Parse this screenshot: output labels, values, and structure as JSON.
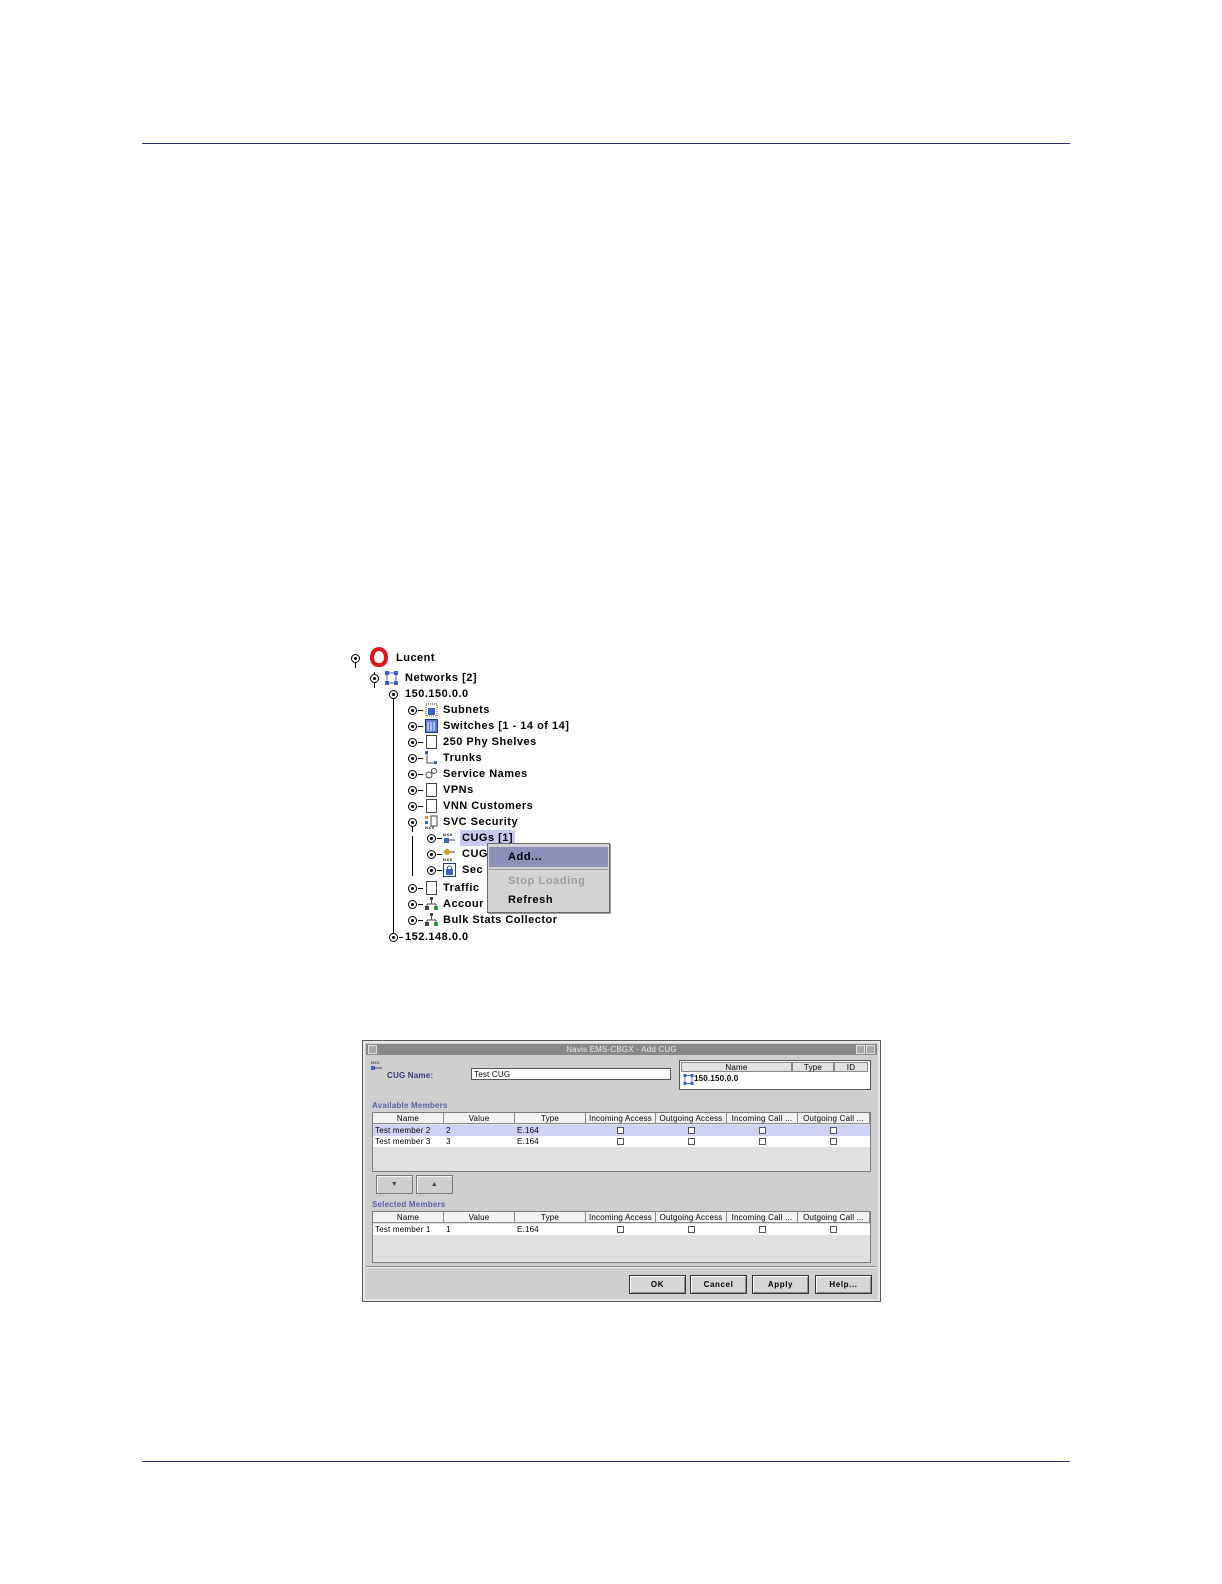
{
  "tree": {
    "root": "Lucent",
    "networks": "Networks [2]",
    "network1": "150.150.0.0",
    "items": [
      "Subnets",
      "Switches [1 - 14 of 14]",
      "250 Phy Shelves",
      "Trunks",
      "Service Names",
      "VPNs",
      "VNN Customers",
      "SVC Security"
    ],
    "svc_children": [
      "CUGs [1]",
      "CUG",
      "Sec"
    ],
    "after_items": [
      "Traffic",
      "Accour",
      "Bulk Stats Collector"
    ],
    "network2": "152.148.0.0"
  },
  "context_menu": {
    "items": [
      "Add...",
      "Stop Loading",
      "Refresh"
    ]
  },
  "dialog": {
    "title": "Navis EMS-CBGX - Add CUG",
    "cug_name_label": "CUG Name:",
    "cug_name_value": "Test CUG",
    "network_table": {
      "headers": [
        "Name",
        "Type",
        "ID"
      ],
      "row": "150.150.0.0"
    },
    "available_title": "Available Members",
    "selected_title": "Selected Members",
    "columns": [
      "Name",
      "Value",
      "Type",
      "Incoming Access",
      "Outgoing Access",
      "Incoming Call ...",
      "Outgoing Call ..."
    ],
    "available_rows": [
      {
        "name": "Test member 2",
        "value": "2",
        "type": "E.164"
      },
      {
        "name": "Test member 3",
        "value": "3",
        "type": "E.164"
      }
    ],
    "selected_rows": [
      {
        "name": "Test member 1",
        "value": "1",
        "type": "E.164"
      }
    ],
    "buttons": {
      "ok": "OK",
      "cancel": "Cancel",
      "apply": "Apply",
      "help": "Help..."
    }
  },
  "colors": {
    "rule": "#2a2f6e",
    "lucent_red": "#e0141b",
    "menu_highlight": "#8d91b8",
    "section_title": "#5860a8"
  }
}
